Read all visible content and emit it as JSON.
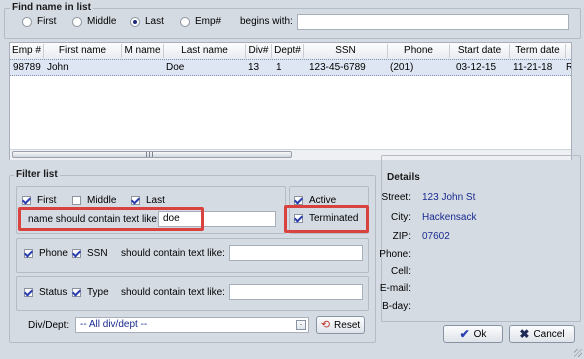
{
  "find": {
    "title": "Find name in list",
    "options": [
      "First",
      "Middle",
      "Last",
      "Emp#"
    ],
    "selected": "Last",
    "begins_with_label": "begins with:",
    "begins_with_value": ""
  },
  "table": {
    "columns": [
      "Emp #",
      "First name",
      "M name",
      "Last name",
      "Div#",
      "Dept#",
      "SSN",
      "Phone",
      "Start date",
      "Term date"
    ],
    "rows": [
      [
        "98789",
        "John",
        "",
        "Doe",
        "13",
        "1",
        "123-45-6789",
        "(201)",
        "03-12-15",
        "11-21-18",
        "R"
      ]
    ]
  },
  "filter": {
    "title": "Filter list",
    "name_checks": [
      {
        "label": "First",
        "checked": true
      },
      {
        "label": "Middle",
        "checked": false
      },
      {
        "label": "Last",
        "checked": true
      }
    ],
    "name_contains_label": "name should contain text like:",
    "name_contains_value": "doe",
    "active_label": "Active",
    "active_checked": true,
    "terminated_label": "Terminated",
    "terminated_checked": true,
    "phone_label": "Phone",
    "ssn_label": "SSN",
    "phone_contains_label": "should contain text like:",
    "phone_contains_value": "",
    "status_label": "Status",
    "type_label": "Type",
    "status_contains_label": "should contain text like:",
    "status_contains_value": "",
    "divdept_label": "Div/Dept:",
    "divdept_value": "-- All div/dept --",
    "reset_label": "Reset"
  },
  "details": {
    "title": "Details",
    "street_label": "Street:",
    "street_value": "123 John St",
    "city_label": "City:",
    "city_value": "Hackensack",
    "zip_label": "ZIP:",
    "zip_value": "07602",
    "phone_label": "Phone:",
    "cell_label": "Cell:",
    "email_label": "E-mail:",
    "bday_label": "B-day:"
  },
  "buttons": {
    "ok": "Ok",
    "cancel": "Cancel"
  },
  "colors": {
    "highlight": "#d9433f",
    "accent_text": "#1a2b8f",
    "selected_row": "#dfe6f3"
  }
}
